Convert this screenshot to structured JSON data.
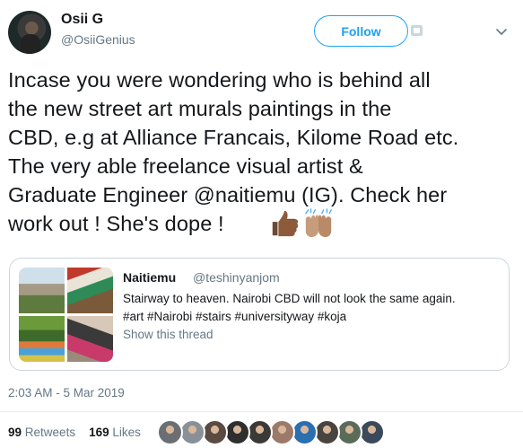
{
  "author": {
    "name": "Osii G",
    "handle": "@OsiiGenius"
  },
  "follow_button": {
    "label": "Follow"
  },
  "tweet": {
    "text": "Incase you were wondering who is behind all\nthe new street art murals paintings in the\nCBD, e.g at Alliance Francais, Kilome Road etc.\nThe very able freelance visual artist &\nGraduate Engineer @naitiemu (IG). Check her\nwork out ! She's dope !",
    "emojis": [
      "thumbs-up-medium-dark-skin",
      "raising-hands-medium-skin"
    ]
  },
  "quoted_tweet": {
    "name": "Naitiemu",
    "handle": "@teshinyanjom",
    "text": "Stairway to heaven. Nairobi CBD will not look the same again.",
    "hashtags": "#art #Nairobi #stairs #universityway #koja",
    "thread_link": "Show this thread",
    "media_count": 4
  },
  "timestamp": "2:03 AM - 5 Mar 2019",
  "stats": {
    "retweets_count": "99",
    "retweets_label": "Retweets",
    "likes_count": "169",
    "likes_label": "Likes"
  },
  "likers": [
    {
      "color": "#6b6f73"
    },
    {
      "color": "#8a9098"
    },
    {
      "color": "#5a4a42"
    },
    {
      "color": "#2f2f2f"
    },
    {
      "color": "#3c3a36"
    },
    {
      "color": "#9b7a6a"
    },
    {
      "color": "#2a6fb0"
    },
    {
      "color": "#4a4440"
    },
    {
      "color": "#5b6b5a"
    },
    {
      "color": "#3a4a5a"
    }
  ],
  "colors": {
    "accent": "#1da1f2",
    "text": "#14171a",
    "secondary": "#657786",
    "border": "#ccd6dd"
  }
}
